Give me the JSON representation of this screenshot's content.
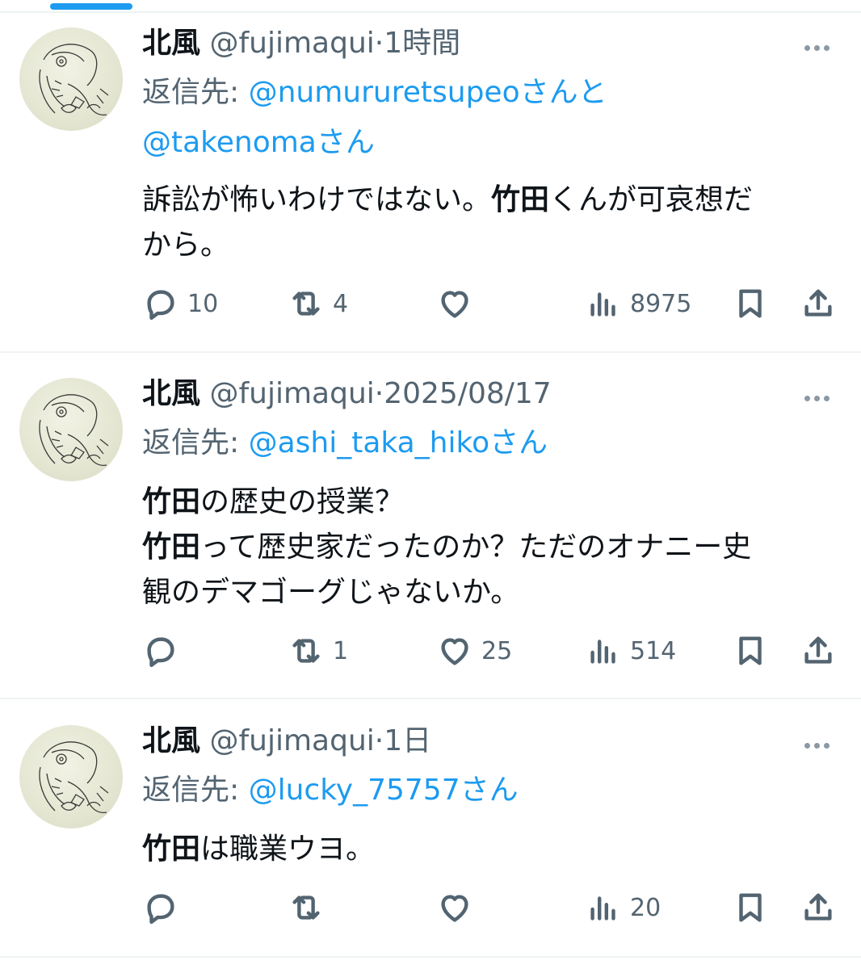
{
  "tweets": [
    {
      "name": "北風",
      "handle": "@fujimaqui",
      "dot": "·",
      "time": "1時間",
      "reply_prefix": "返信先:",
      "mention1": "@numururetsupeo",
      "reply_join": "さんと",
      "mention2": "@takenoma",
      "reply_suffix": "さん",
      "body": [
        {
          "text": "訴訟が怖いわけではない。",
          "bold": false
        },
        {
          "text": "竹田",
          "bold": true
        },
        {
          "text": "くんが可哀想だ",
          "bold": false
        },
        {
          "text": "から。",
          "bold": false
        }
      ],
      "replies": "10",
      "retweets": "4",
      "likes": "",
      "views": "8975"
    },
    {
      "name": "北風",
      "handle": "@fujimaqui",
      "dot": "·",
      "time": "2025/08/17",
      "reply_prefix": "返信先:",
      "mention1": "@ashi_taka_hiko",
      "reply_suffix": "さん",
      "body": [
        {
          "text": "竹田",
          "bold": true
        },
        {
          "text": "の歴史の授業？",
          "bold": false
        },
        {
          "text": "竹田",
          "bold": true
        },
        {
          "text": "って歴史家だったのか？ただのオナニー史",
          "bold": false
        },
        {
          "text": "観のデマゴーグじゃないか。",
          "bold": false
        }
      ],
      "replies": "",
      "retweets": "1",
      "likes": "25",
      "views": "514"
    },
    {
      "name": "北風",
      "handle": "@fujimaqui",
      "dot": "·",
      "time": "1日",
      "reply_prefix": "返信先:",
      "mention1": "@lucky_75757",
      "reply_suffix": "さん",
      "body": [
        {
          "text": "竹田",
          "bold": true
        },
        {
          "text": "は職業ウヨ。",
          "bold": false
        }
      ],
      "replies": "",
      "retweets": "",
      "likes": "",
      "views": "20"
    }
  ],
  "icons": {
    "reply": "reply-icon",
    "retweet": "retweet-icon",
    "like": "heart-icon",
    "views": "views-icon",
    "bookmark": "bookmark-icon",
    "share": "share-icon",
    "more": "more-icon"
  },
  "colors": {
    "accent": "#1d9bf0",
    "text": "#0f1419",
    "secondary": "#536471",
    "divider": "#eff3f4"
  }
}
